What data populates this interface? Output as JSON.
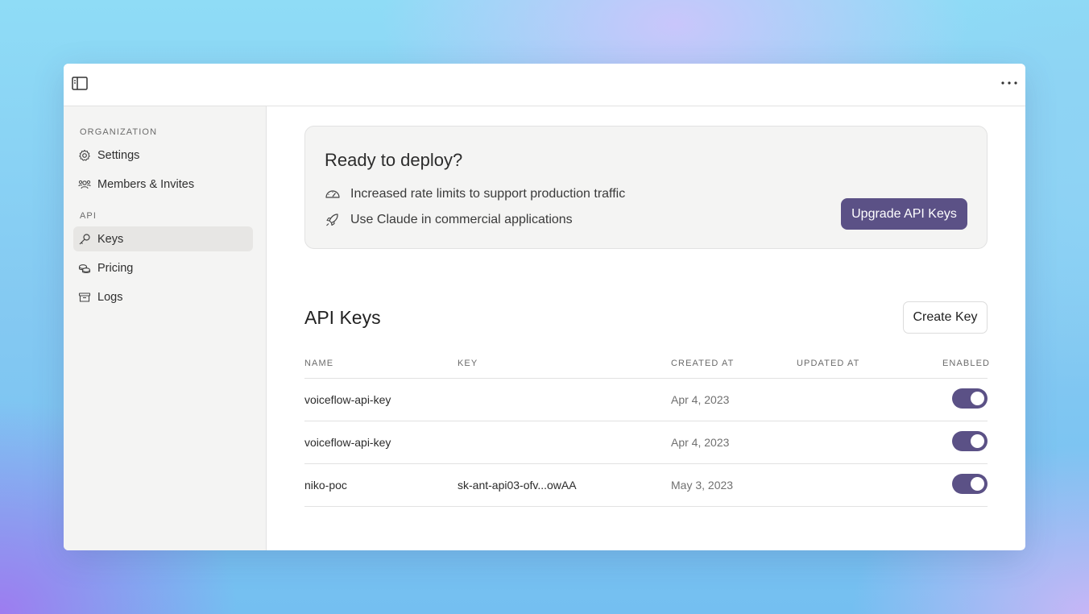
{
  "sidebar": {
    "sections": [
      {
        "label": "ORGANIZATION",
        "items": [
          {
            "label": "Settings",
            "icon": "gear-icon"
          },
          {
            "label": "Members & Invites",
            "icon": "people-icon"
          }
        ]
      },
      {
        "label": "API",
        "items": [
          {
            "label": "Keys",
            "icon": "key-icon",
            "active": true
          },
          {
            "label": "Pricing",
            "icon": "coins-icon"
          },
          {
            "label": "Logs",
            "icon": "archive-icon"
          }
        ]
      }
    ]
  },
  "promo": {
    "title": "Ready to deploy?",
    "features": [
      {
        "icon": "speedometer-icon",
        "text": "Increased rate limits to support production traffic"
      },
      {
        "icon": "rocket-icon",
        "text": "Use Claude in commercial applications"
      }
    ],
    "button_label": "Upgrade API Keys"
  },
  "keys": {
    "title": "API Keys",
    "create_button_label": "Create Key",
    "columns": [
      "NAME",
      "KEY",
      "CREATED AT",
      "UPDATED AT",
      "ENABLED"
    ],
    "rows": [
      {
        "name": "voiceflow-api-key",
        "key": "",
        "created_at": "Apr 4, 2023",
        "updated_at": "",
        "enabled": true
      },
      {
        "name": "voiceflow-api-key",
        "key": "",
        "created_at": "Apr 4, 2023",
        "updated_at": "",
        "enabled": true
      },
      {
        "name": "niko-poc",
        "key": "sk-ant-api03-ofv...owAA",
        "created_at": "May 3, 2023",
        "updated_at": "",
        "enabled": true
      }
    ]
  },
  "colors": {
    "accent": "#5b5186",
    "sidebar_bg": "#f4f4f3",
    "border": "#e2e2e2"
  }
}
